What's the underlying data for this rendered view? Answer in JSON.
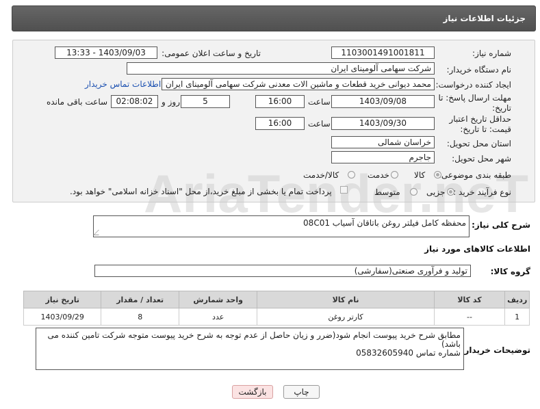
{
  "header": {
    "title": "جزئیات اطلاعات نیاز"
  },
  "form": {
    "need_number_label": "شماره نیاز:",
    "need_number_value": "1103001491001811",
    "announce_label": "تاریخ و ساعت اعلان عمومی:",
    "announce_value": "1403/09/03 - 13:33",
    "buyer_org_label": "نام دستگاه خریدار:",
    "buyer_org_value": "شرکت سهامی آلومینای ایران",
    "requester_label": "ایجاد کننده درخواست:",
    "requester_value": "محمد دیوانی خرید قطعات و ماشین الات معدنی شرکت سهامی آلومینای ایران",
    "buyer_contact_link": "اطلاعات تماس خریدار",
    "reply_deadline_label": "مهلت ارسال پاسخ: تا تاریخ:",
    "reply_date": "1403/09/08",
    "time_label": "ساعت",
    "reply_time": "16:00",
    "days_value": "5",
    "days_label": "روز و",
    "remaining_time": "02:08:02",
    "remaining_label": "ساعت باقی مانده",
    "price_validity_label": "حداقل تاریخ اعتبار قیمت: تا تاریخ:",
    "validity_date": "1403/09/30",
    "validity_time": "16:00",
    "province_label": "استان محل تحویل:",
    "province_value": "خراسان شمالی",
    "city_label": "شهر محل تحویل:",
    "city_value": "جاجرم",
    "category_label": "طبقه بندی موضوعی:",
    "category_options": [
      "کالا",
      "خدمت",
      "کالا/خدمت"
    ],
    "category_selected": "کالا",
    "process_label": "نوع فرآیند خرید :",
    "process_options": [
      "جزیی",
      "متوسط"
    ],
    "process_selected": "جزیی",
    "payment_note": "پرداخت تمام یا بخشی از مبلغ خرید،از محل \"اسناد خزانه اسلامی\" خواهد بود."
  },
  "description": {
    "label": "شرح کلی نیاز:",
    "value": "محفظه کامل فیلتر روغن باتاقان  آسیاب 08C01"
  },
  "goods_section": {
    "title": "اطلاعات کالاهای مورد نیاز",
    "group_label": "گروه کالا:",
    "group_value": "تولید و فرآوری صنعتی(سفارشی)"
  },
  "table": {
    "headers": [
      "ردیف",
      "کد کالا",
      "نام کالا",
      "واحد شمارش",
      "تعداد / مقدار",
      "تاریخ نیاز"
    ],
    "rows": [
      [
        "1",
        "--",
        "کارتر روغن",
        "عدد",
        "8",
        "1403/09/29"
      ]
    ]
  },
  "buyer_notes": {
    "label": "توضیحات خریدار:",
    "line1": "مطابق شرح خرید پیوست انجام شود(ضرر و زیان حاصل از عدم توجه به شرح خرید پیوست متوجه شرکت تامین کننده می",
    "line2": "باشد)",
    "line3": "شماره تماس 05832605940"
  },
  "buttons": {
    "print": "چاپ",
    "back": "بازگشت"
  },
  "watermark": "AriaTender.neT"
}
